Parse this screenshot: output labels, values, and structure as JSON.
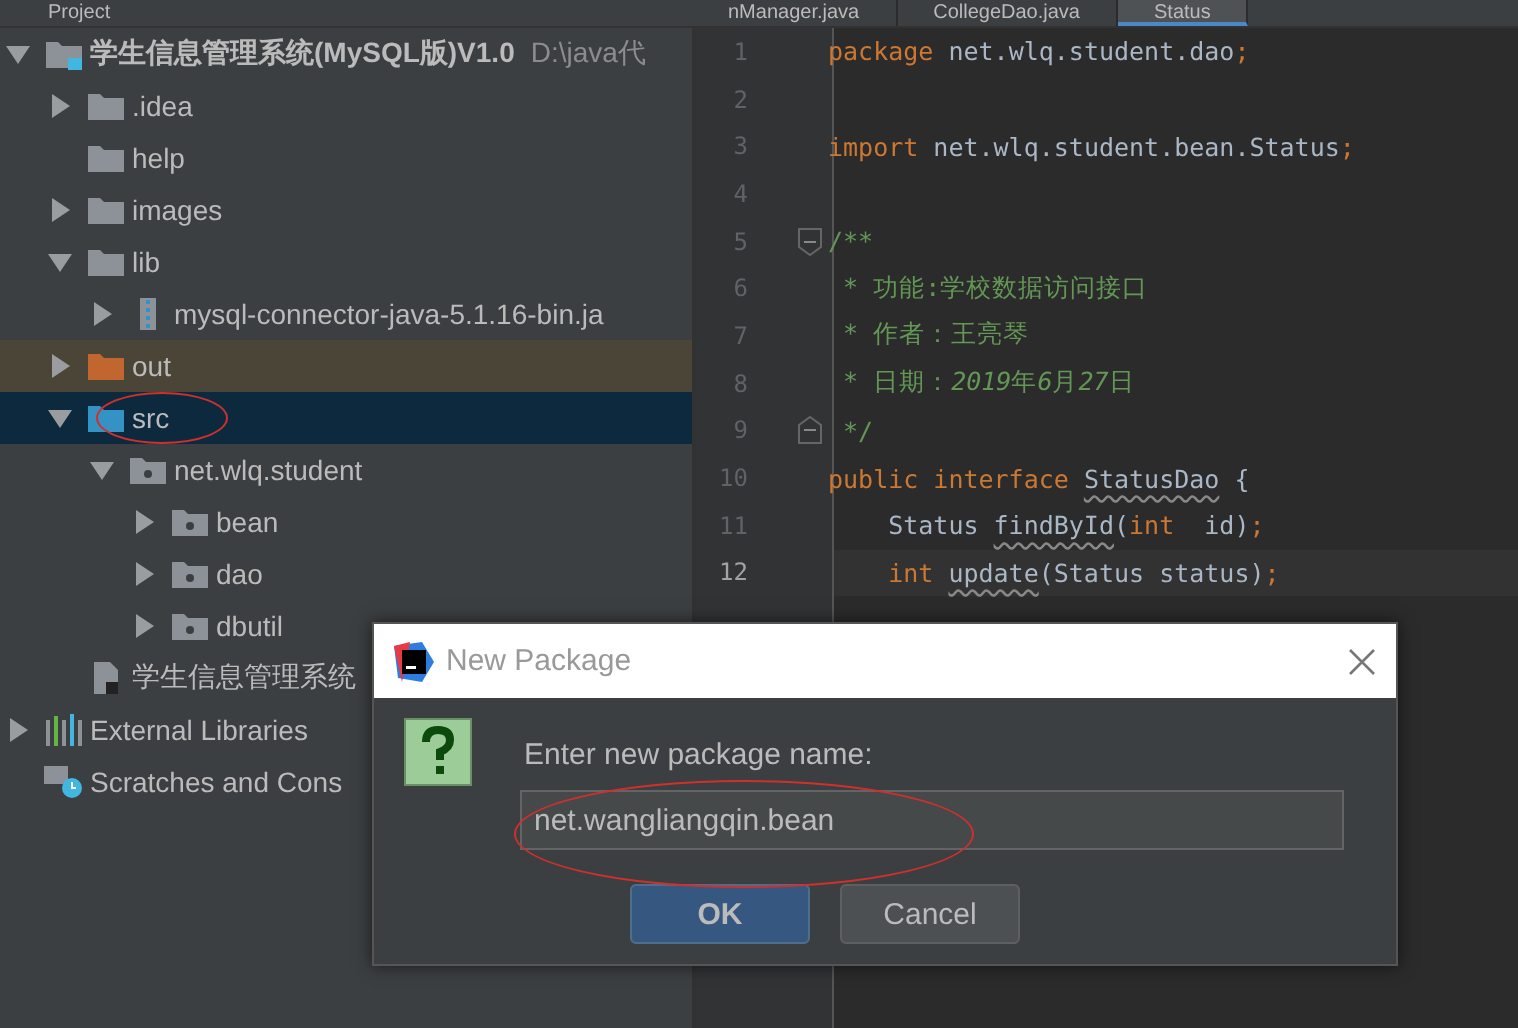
{
  "top_bar": {
    "panel_title": "Project",
    "tabs": [
      {
        "label": "nManager.java",
        "selected": false
      },
      {
        "label": "CollegeDao.java",
        "selected": false
      },
      {
        "label": "Status",
        "selected": true
      }
    ]
  },
  "project_tree": [
    {
      "label": "学生信息管理系统(MySQL版)V1.0",
      "path": "D:\\java代",
      "kind": "module",
      "expanded": true,
      "selected": false,
      "children": [
        {
          "label": ".idea",
          "kind": "folder",
          "expanded": false,
          "selected": false
        },
        {
          "label": "help",
          "kind": "folder",
          "selected": false
        },
        {
          "label": "images",
          "kind": "folder",
          "expanded": false,
          "selected": false
        },
        {
          "label": "lib",
          "kind": "folder",
          "expanded": true,
          "selected": false,
          "children": [
            {
              "label": "mysql-connector-java-5.1.16-bin.ja",
              "kind": "jar",
              "expanded": false,
              "selected": false
            }
          ]
        },
        {
          "label": "out",
          "kind": "excluded",
          "expanded": false,
          "selected": false
        },
        {
          "label": "src",
          "kind": "source",
          "expanded": true,
          "selected": true,
          "children": [
            {
              "label": "net.wlq.student",
              "kind": "package",
              "expanded": true,
              "selected": false,
              "children": [
                {
                  "label": "bean",
                  "kind": "package",
                  "expanded": false,
                  "selected": false
                },
                {
                  "label": "dao",
                  "kind": "package",
                  "expanded": false,
                  "selected": false
                },
                {
                  "label": "dbutil",
                  "kind": "package",
                  "expanded": false,
                  "selected": false
                }
              ]
            }
          ]
        },
        {
          "label": "学生信息管理系统",
          "kind": "iml",
          "selected": false
        }
      ]
    },
    {
      "label": "External Libraries",
      "kind": "libraries",
      "expanded": false,
      "selected": false
    },
    {
      "label": "Scratches and Cons",
      "kind": "scratches",
      "selected": false
    }
  ],
  "editor": {
    "lines": [
      {
        "number": "1",
        "current": false,
        "indent": false,
        "tokens": [
          {
            "kind": "keyword",
            "text": "package"
          },
          {
            "kind": "plain",
            "text": " net.wlq.student.dao"
          },
          {
            "kind": "keyword",
            "text": ";"
          }
        ]
      },
      {
        "number": "2",
        "current": false
      },
      {
        "number": "3",
        "current": false,
        "indent": false,
        "tokens": [
          {
            "kind": "keyword",
            "text": "import"
          },
          {
            "kind": "plain",
            "text": " net.wlq.student.bean.Status"
          },
          {
            "kind": "keyword",
            "text": ";"
          }
        ]
      },
      {
        "number": "4",
        "current": false
      },
      {
        "number": "5",
        "current": false,
        "indent": false,
        "fold_start": true,
        "tokens": [
          {
            "kind": "doc",
            "text": "/**"
          }
        ]
      },
      {
        "number": "6",
        "current": false,
        "indent": false,
        "tokens": [
          {
            "kind": "doc",
            "text": " * 功能:学校数据访问接口"
          }
        ]
      },
      {
        "number": "7",
        "current": false,
        "indent": false,
        "tokens": [
          {
            "kind": "doc",
            "text": " * 作者：王亮琴"
          }
        ]
      },
      {
        "number": "8",
        "current": false,
        "indent": false,
        "tokens": [
          {
            "kind": "doc",
            "text": " * 日期："
          },
          {
            "kind": "docnum",
            "text": "2019"
          },
          {
            "kind": "doc",
            "text": "年"
          },
          {
            "kind": "docnum",
            "text": "6"
          },
          {
            "kind": "doc",
            "text": "月"
          },
          {
            "kind": "docnum",
            "text": "27"
          },
          {
            "kind": "doc",
            "text": "日"
          }
        ]
      },
      {
        "number": "9",
        "current": false,
        "indent": false,
        "fold_end": true,
        "tokens": [
          {
            "kind": "doc",
            "text": " */"
          }
        ]
      },
      {
        "number": "10",
        "current": false,
        "indent": false,
        "tokens": [
          {
            "kind": "keyword",
            "text": "public interface "
          },
          {
            "kind": "unused",
            "text": "StatusDao"
          },
          {
            "kind": "plain",
            "text": " {"
          }
        ]
      },
      {
        "number": "11",
        "current": false,
        "indent": true,
        "tokens": [
          {
            "kind": "plain",
            "text": "Status "
          },
          {
            "kind": "unused",
            "text": "findById"
          },
          {
            "kind": "plain",
            "text": "("
          },
          {
            "kind": "keyword",
            "text": "int"
          },
          {
            "kind": "plain",
            "text": "  id)"
          },
          {
            "kind": "keyword",
            "text": ";"
          }
        ]
      },
      {
        "number": "12",
        "current": true,
        "indent": true,
        "tokens": [
          {
            "kind": "keyword",
            "text": "int "
          },
          {
            "kind": "unused",
            "text": "update"
          },
          {
            "kind": "plain",
            "text": "(Status status)"
          },
          {
            "kind": "keyword",
            "text": ";"
          }
        ]
      }
    ]
  },
  "dialog": {
    "title": "New Package",
    "prompt": "Enter new package name:",
    "value": "net.wangliangqin.bean",
    "buttons": [
      {
        "label": "OK",
        "default": true
      },
      {
        "label": "Cancel",
        "default": false
      }
    ]
  }
}
